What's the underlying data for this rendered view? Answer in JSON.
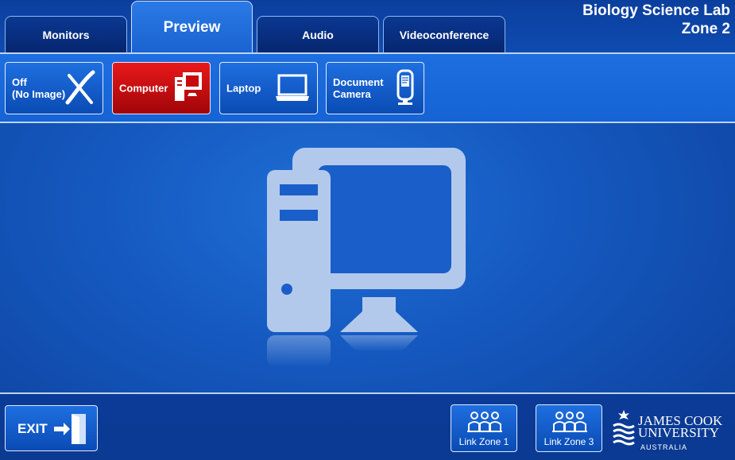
{
  "header": {
    "title_line1": "Biology Science Lab",
    "title_line2": "Zone 2",
    "tabs": [
      {
        "label": "Monitors"
      },
      {
        "label": "Preview"
      },
      {
        "label": "Audio"
      },
      {
        "label": "Videoconference"
      }
    ],
    "active_tab": "Preview"
  },
  "sources": [
    {
      "label": "Off\n(No Image)",
      "icon": "x-icon"
    },
    {
      "label": "Computer",
      "icon": "computer-icon"
    },
    {
      "label": "Laptop",
      "icon": "laptop-icon"
    },
    {
      "label": "Document\nCamera",
      "icon": "document-camera-icon"
    }
  ],
  "selected_source": "Computer",
  "preview": {
    "icon": "computer-icon"
  },
  "footer": {
    "exit_label": "EXIT",
    "link_zone_1": "Link Zone 1",
    "link_zone_3": "Link Zone 3",
    "logo_line1": "JAMES COOK",
    "logo_line2": "UNIVERSITY",
    "logo_line3": "AUSTRALIA"
  },
  "colors": {
    "selected": "#c8090c",
    "accent": "#1563d4"
  }
}
